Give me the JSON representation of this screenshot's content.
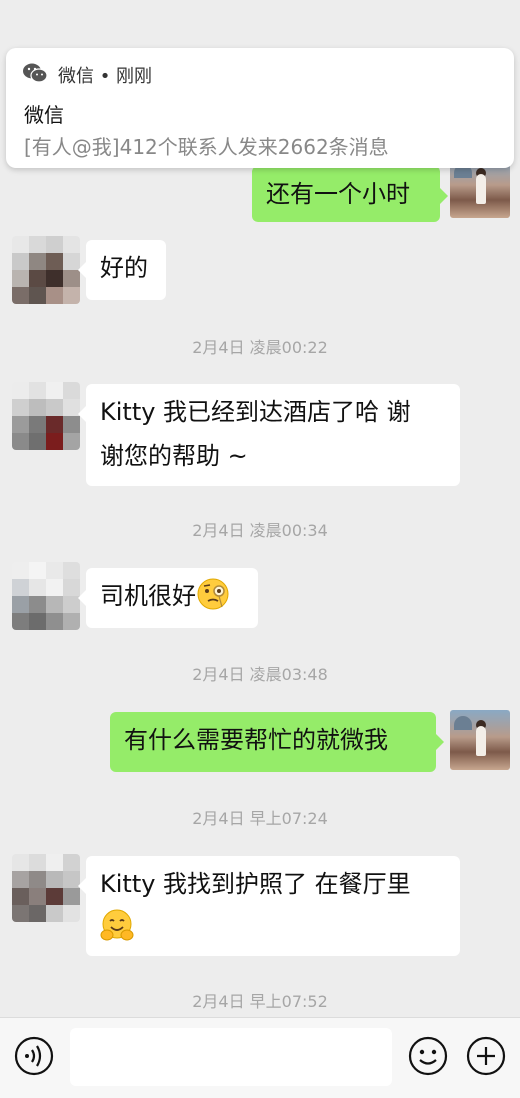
{
  "notification": {
    "app_name": "微信 • 刚刚",
    "title": "微信",
    "body": "[有人@我]412个联系人发来2662条消息"
  },
  "messages": [
    {
      "side": "out",
      "text": "还有一个小时"
    },
    {
      "side": "in",
      "text": "好的"
    },
    {
      "timestamp": "2月4日 凌晨00:22"
    },
    {
      "side": "in",
      "line1": "Kitty 我已经到达酒店了哈  谢",
      "line2": "谢您的帮助 ~"
    },
    {
      "timestamp": "2月4日 凌晨00:34"
    },
    {
      "side": "in",
      "text": "司机很好",
      "emoji": "face-with-monocle"
    },
    {
      "timestamp": "2月4日 凌晨03:48"
    },
    {
      "side": "out",
      "text": "有什么需要帮忙的就微我"
    },
    {
      "timestamp": "2月4日 早上07:24"
    },
    {
      "side": "in",
      "text": "Kitty 我找到护照了 在餐厅里",
      "emoji": "hugging-face"
    },
    {
      "timestamp": "2月4日 早上07:52"
    }
  ],
  "icons": {
    "wechat": "wechat-icon",
    "voice": "voice-icon",
    "emoji": "emoji-icon",
    "plus": "plus-icon"
  },
  "colors": {
    "background": "#ededed",
    "outgoing_bubble": "#95ec69",
    "incoming_bubble": "#ffffff",
    "timestamp": "#a6a6a6"
  }
}
